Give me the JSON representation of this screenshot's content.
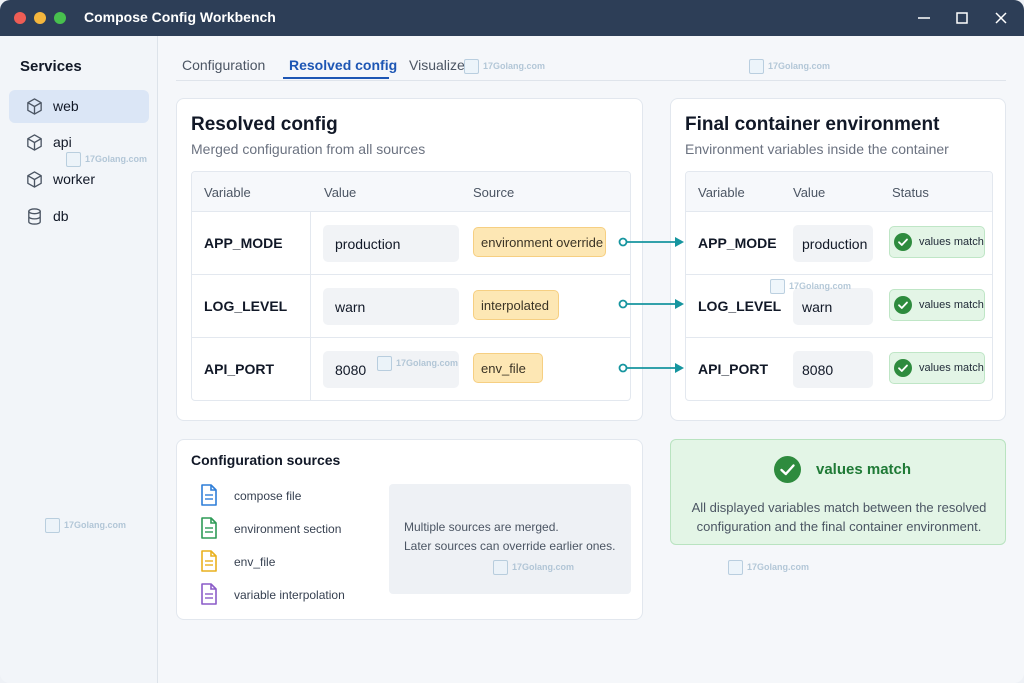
{
  "window": {
    "title": "Compose Config Workbench"
  },
  "sidebar": {
    "title": "Services",
    "items": [
      {
        "label": "web",
        "icon": "cube-icon",
        "active": true
      },
      {
        "label": "api",
        "icon": "cube-icon",
        "active": false
      },
      {
        "label": "worker",
        "icon": "cube-icon",
        "active": false
      },
      {
        "label": "db",
        "icon": "database-icon",
        "active": false
      }
    ]
  },
  "tabs": [
    {
      "label": "Configuration",
      "active": false
    },
    {
      "label": "Resolved config",
      "active": true
    },
    {
      "label": "Visualize",
      "active": false
    }
  ],
  "resolved": {
    "title": "Resolved config",
    "subtitle": "Merged configuration from all sources",
    "headers": {
      "variable": "Variable",
      "value": "Value",
      "source": "Source"
    },
    "rows": [
      {
        "variable": "APP_MODE",
        "value": "production",
        "source": "environment override"
      },
      {
        "variable": "LOG_LEVEL",
        "value": "warn",
        "source": "interpolated"
      },
      {
        "variable": "API_PORT",
        "value": "8080",
        "source": "env_file"
      }
    ]
  },
  "final_env": {
    "title": "Final container environment",
    "subtitle": "Environment variables inside the container",
    "headers": {
      "variable": "Variable",
      "value": "Value",
      "status": "Status"
    },
    "rows": [
      {
        "variable": "APP_MODE",
        "value": "production",
        "status": "values match"
      },
      {
        "variable": "LOG_LEVEL",
        "value": "warn",
        "status": "values match"
      },
      {
        "variable": "API_PORT",
        "value": "8080",
        "status": "values match"
      }
    ]
  },
  "sources": {
    "title": "Configuration sources",
    "items": [
      {
        "label": "compose file",
        "icon": "file-icon",
        "color": "#2f7ed8"
      },
      {
        "label": "environment section",
        "icon": "file-icon",
        "color": "#2e9b57"
      },
      {
        "label": "env_file",
        "icon": "file-icon",
        "color": "#e9b11f"
      },
      {
        "label": "variable interpolation",
        "icon": "file-icon",
        "color": "#8b5cc8"
      }
    ],
    "note_line1": "Multiple sources are merged.",
    "note_line2": "Later sources can override earlier ones."
  },
  "match": {
    "title": "values match",
    "description": "All displayed variables match between the resolved configuration and the final container environment."
  },
  "watermark": "17Golang.com",
  "colors": {
    "titlebar": "#2d3e57",
    "accent": "#1d56b4",
    "source_badge": "#fde7b4",
    "success": "#2e8b3e",
    "success_bg": "#e3f5e6",
    "connector": "#16959f"
  }
}
